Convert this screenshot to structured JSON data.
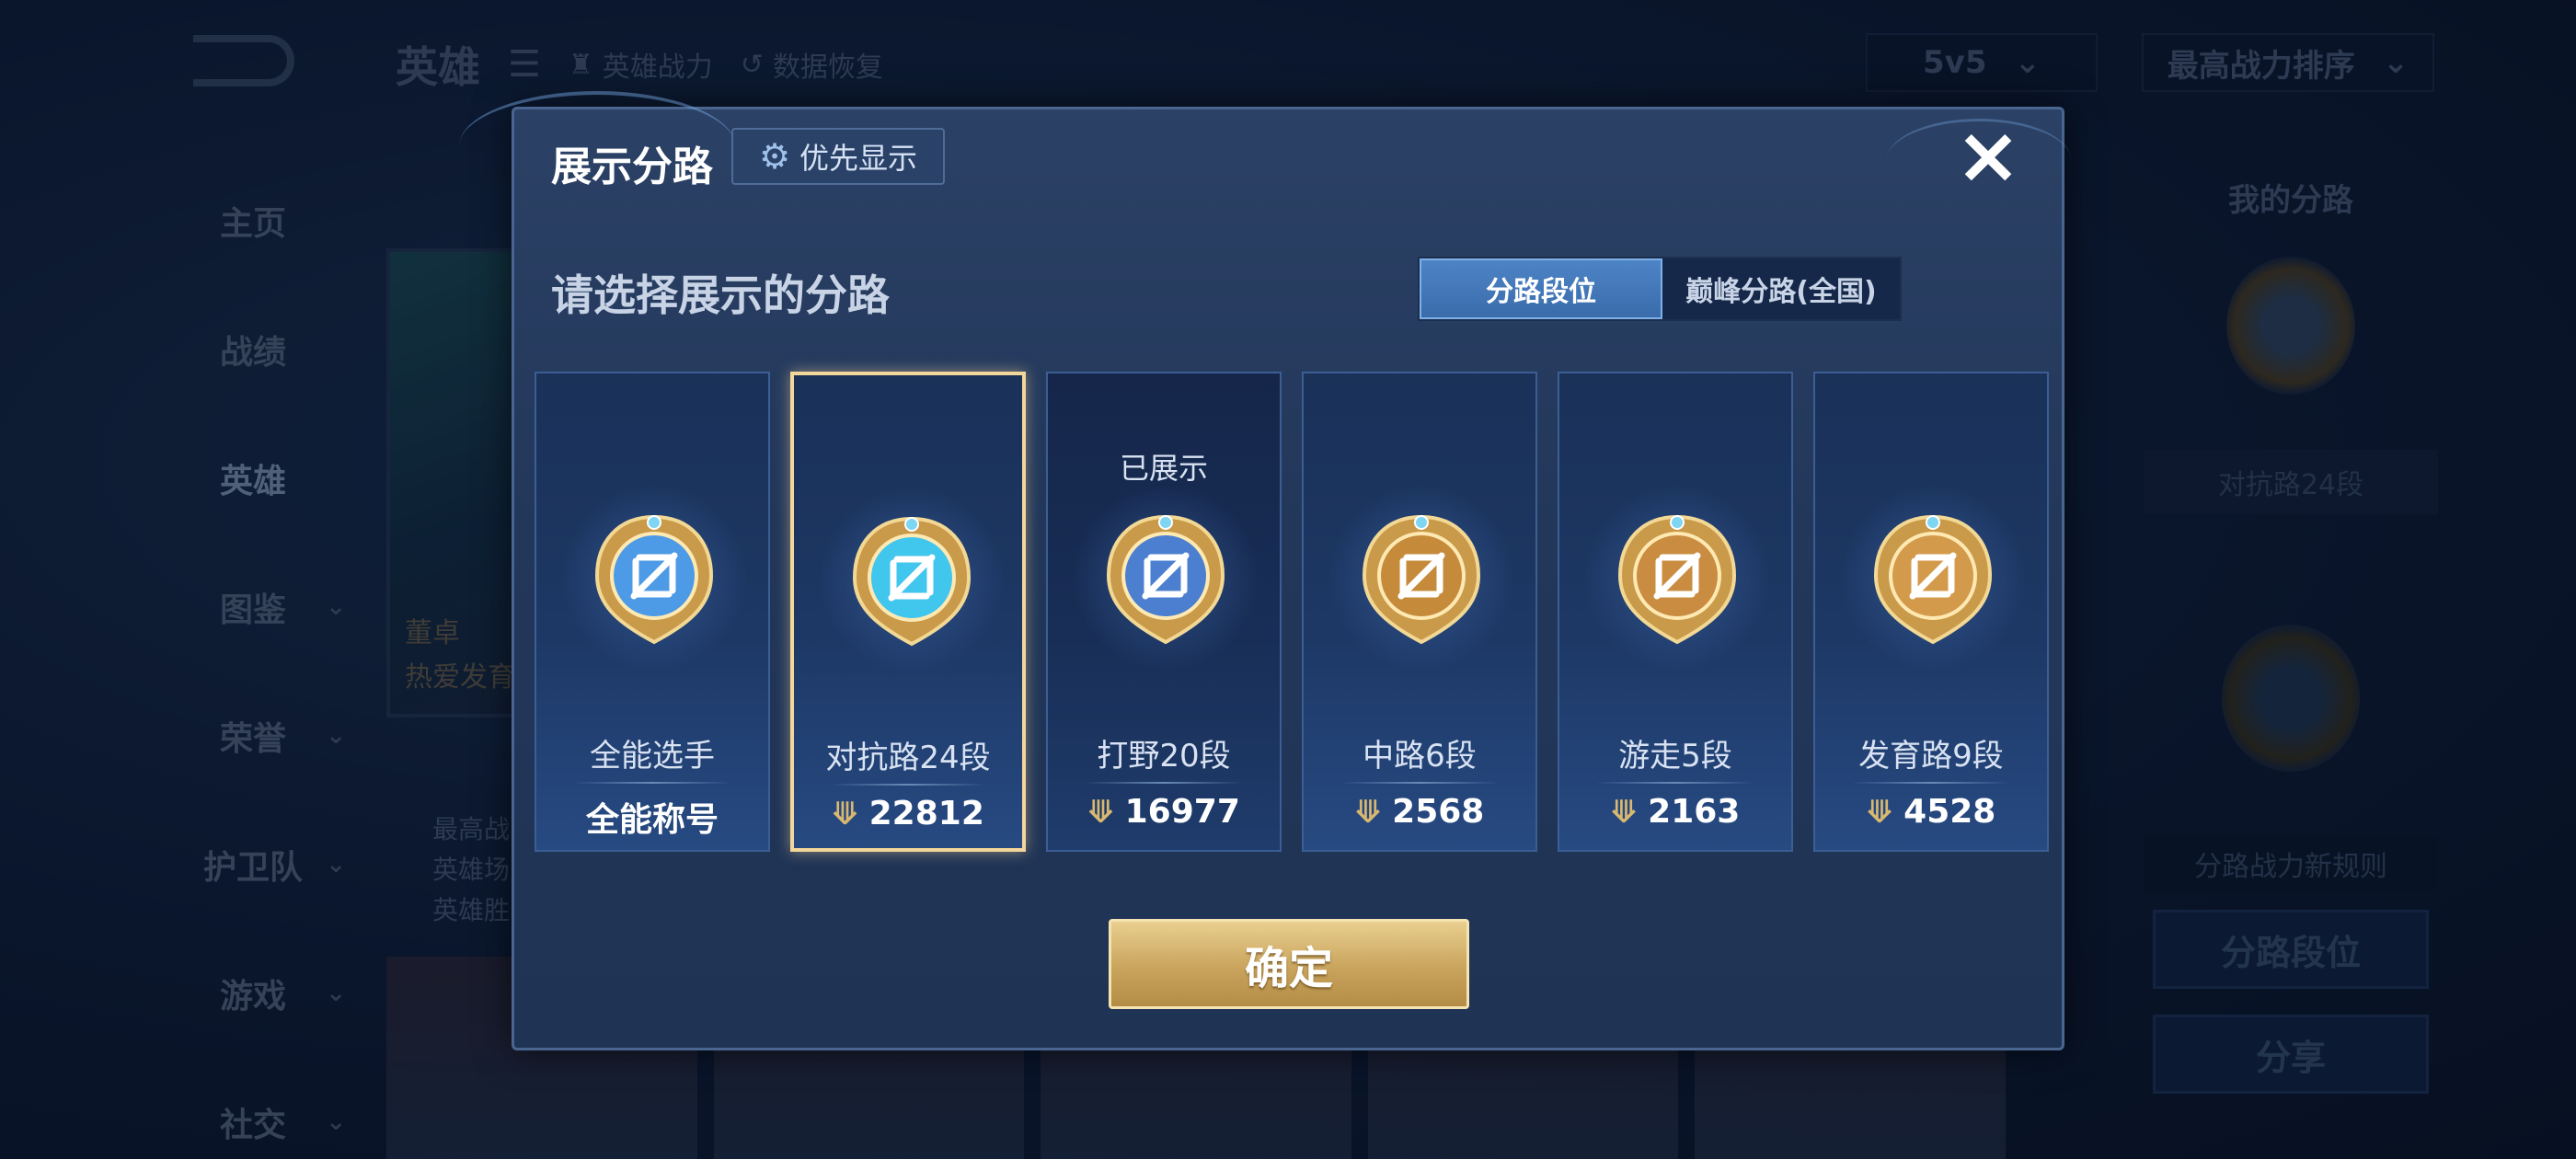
{
  "background": {
    "nav": [
      {
        "label": "主页",
        "chevron": false
      },
      {
        "label": "战绩",
        "chevron": false
      },
      {
        "label": "英雄",
        "chevron": false,
        "active": true
      },
      {
        "label": "图鉴",
        "chevron": true
      },
      {
        "label": "荣誉",
        "chevron": true
      },
      {
        "label": "护卫队",
        "chevron": true
      },
      {
        "label": "游戏",
        "chevron": true
      },
      {
        "label": "社交",
        "chevron": true
      }
    ],
    "topbar": {
      "title": "英雄",
      "hero_power_link": "英雄战力",
      "data_restore_link": "数据恢复",
      "mode_select": "5v5",
      "sort_select": "最高战力排序"
    },
    "hero_card_label_1": "董卓",
    "hero_card_label_2": "热爱发育",
    "bg_lines": [
      "最高战",
      "英雄场",
      "英雄胜"
    ],
    "right_panel": {
      "title": "我的分路",
      "lane_label": "对抗路24段",
      "rule_text": "分路战力新规则",
      "lane_rank_button": "分路段位",
      "share_button": "分享"
    }
  },
  "modal": {
    "title": "展示分路",
    "priority_button": "优先显示",
    "close_icon": "×",
    "subtitle": "请选择展示的分路",
    "tabs": [
      {
        "label": "分路段位",
        "active": true
      },
      {
        "label": "巅峰分路(全国)",
        "active": false
      }
    ],
    "cards": [
      {
        "name": "全能选手",
        "power": "全能称号",
        "badge": "all-round-badge",
        "shown": false,
        "selected": false,
        "power_icon": false,
        "emblem": "#4d9ae6"
      },
      {
        "name": "对抗路24段",
        "power": "22812",
        "badge": "clash-lane-badge",
        "shown": false,
        "selected": true,
        "power_icon": true,
        "emblem": "#41c6ee"
      },
      {
        "name": "打野20段",
        "power": "16977",
        "badge": "jungle-badge",
        "shown": true,
        "shown_label": "已展示",
        "selected": false,
        "power_icon": true,
        "emblem": "#4c7fd0"
      },
      {
        "name": "中路6段",
        "power": "2568",
        "badge": "mid-lane-badge",
        "shown": false,
        "selected": false,
        "power_icon": true,
        "emblem": "#c58b3a"
      },
      {
        "name": "游走5段",
        "power": "2163",
        "badge": "roam-badge",
        "shown": false,
        "selected": false,
        "power_icon": true,
        "emblem": "#c98c40"
      },
      {
        "name": "发育路9段",
        "power": "4528",
        "badge": "farm-lane-badge",
        "shown": false,
        "selected": false,
        "power_icon": true,
        "emblem": "#d49a4c"
      }
    ],
    "confirm_button": "确定"
  },
  "colors": {
    "accent_gold": "#e9cf8e",
    "selected_border": "#f3d69a",
    "tab_active": "#4d84c6"
  }
}
